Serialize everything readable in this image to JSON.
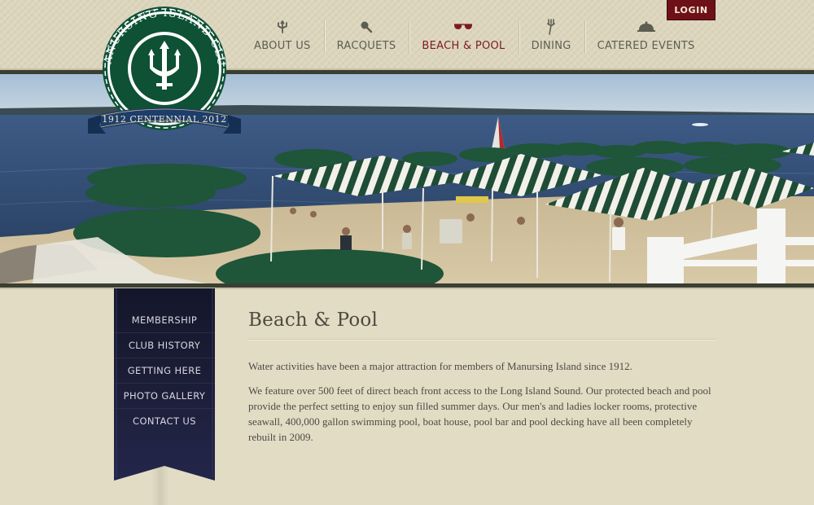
{
  "logo": {
    "top_text": "MANURSING ISLAND CLUB",
    "banner_text": "1912 CENTENNIAL 2012"
  },
  "login": {
    "label": "LOGIN"
  },
  "nav": {
    "items": [
      {
        "label": "ABOUT US",
        "icon": "trident-icon"
      },
      {
        "label": "RACQUETS",
        "icon": "tennis-racquet-icon"
      },
      {
        "label": "BEACH & POOL",
        "icon": "sunglasses-icon"
      },
      {
        "label": "DINING",
        "icon": "fork-icon"
      },
      {
        "label": "CATERED EVENTS",
        "icon": "cloche-icon"
      }
    ],
    "active_index": 2
  },
  "sidebar": {
    "items": [
      {
        "label": "MEMBERSHIP"
      },
      {
        "label": "CLUB HISTORY"
      },
      {
        "label": "GETTING HERE"
      },
      {
        "label": "PHOTO GALLERY"
      },
      {
        "label": "CONTACT US"
      }
    ]
  },
  "main": {
    "title": "Beach & Pool",
    "paragraphs": [
      "Water activities have been a major attraction for members of Manursing Island since 1912.",
      "We feature over 500 feet of direct beach front access to the Long Island Sound.  Our protected beach and pool provide the perfect setting to enjoy sun filled summer days.  Our men's and ladies locker rooms, protective seawall, 400,000 gallon swimming pool, boat house, pool bar and pool decking have all been completely rebuilt in 2009."
    ]
  },
  "colors": {
    "background": "#e2dcc5",
    "accent_red": "#7d1b22",
    "login_red": "#6e1018",
    "ribbon_navy": "#1b1d35",
    "logo_green": "#0e5135",
    "banner_navy": "#1d3d6a"
  }
}
